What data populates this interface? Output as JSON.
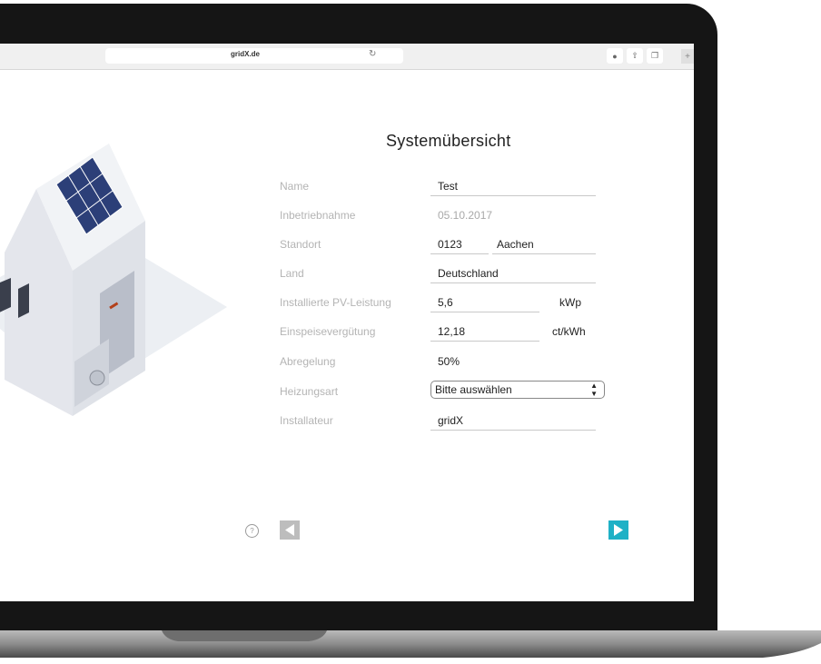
{
  "browser": {
    "url": "gridX.de",
    "icons": [
      "download-icon",
      "share-icon",
      "tabs-icon",
      "plus-icon"
    ]
  },
  "form": {
    "title": "Systemübersicht",
    "fields": {
      "name": {
        "label": "Name",
        "value": "Test"
      },
      "commissioning": {
        "label": "Inbetriebnahme",
        "value": "05.10.2017"
      },
      "location": {
        "label": "Standort",
        "zip": "0123",
        "city": "Aachen"
      },
      "country": {
        "label": "Land",
        "value": "Deutschland"
      },
      "pv_power": {
        "label": "Installierte PV-Leistung",
        "value": "5,6",
        "unit": "kWp"
      },
      "feed_in": {
        "label": "Einspeisevergütung",
        "value": "12,18",
        "unit": "ct/kWh"
      },
      "curtailment": {
        "label": "Abregelung",
        "value": "50%"
      },
      "heating": {
        "label": "Heizungsart",
        "value": "Bitte auswählen"
      },
      "installer": {
        "label": "Installateur",
        "value": "gridX"
      }
    }
  },
  "nav": {
    "help_symbol": "?",
    "prev_icon": "triangle-left-icon",
    "next_icon": "triangle-right-icon"
  },
  "colors": {
    "accent": "#1fb1c6",
    "label_gray": "#b4b4b4",
    "bezel": "#151515"
  }
}
